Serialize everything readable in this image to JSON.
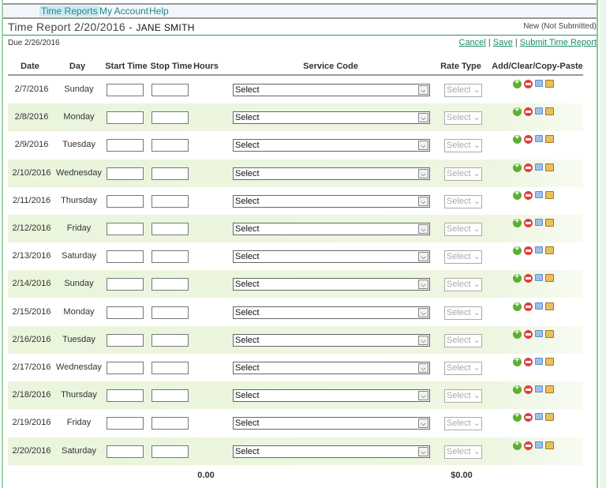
{
  "nav": {
    "items": [
      "Time Reports",
      "My Account",
      "Help"
    ],
    "active": "Time Reports"
  },
  "header": {
    "title": "Time Report 2/20/2016 - ",
    "name": "JANE SMITH",
    "status": "New (Not Submitted)",
    "due": "Due 2/26/2016"
  },
  "actions": {
    "cancel": "Cancel",
    "save": "Save",
    "submit": "Submit Time Report",
    "sep": "|"
  },
  "columns": {
    "date": "Date",
    "day": "Day",
    "start": "Start Time",
    "stop": "Stop Time",
    "hours": "Hours",
    "service": "Service Code",
    "rate": "Rate Type",
    "tools": "Add/Clear/Copy-Paste"
  },
  "rows": [
    {
      "date": "2/7/2016",
      "day": "Sunday"
    },
    {
      "date": "2/8/2016",
      "day": "Monday"
    },
    {
      "date": "2/9/2016",
      "day": "Tuesday"
    },
    {
      "date": "2/10/2016",
      "day": "Wednesday"
    },
    {
      "date": "2/11/2016",
      "day": "Thursday"
    },
    {
      "date": "2/12/2016",
      "day": "Friday"
    },
    {
      "date": "2/13/2016",
      "day": "Saturday"
    },
    {
      "date": "2/14/2016",
      "day": "Sunday"
    },
    {
      "date": "2/15/2016",
      "day": "Monday"
    },
    {
      "date": "2/16/2016",
      "day": "Tuesday"
    },
    {
      "date": "2/17/2016",
      "day": "Wednesday"
    },
    {
      "date": "2/18/2016",
      "day": "Thursday"
    },
    {
      "date": "2/19/2016",
      "day": "Friday"
    },
    {
      "date": "2/20/2016",
      "day": "Saturday"
    }
  ],
  "select_placeholder": "Select",
  "totals": {
    "hours": "0.00",
    "amount": "$0.00"
  }
}
